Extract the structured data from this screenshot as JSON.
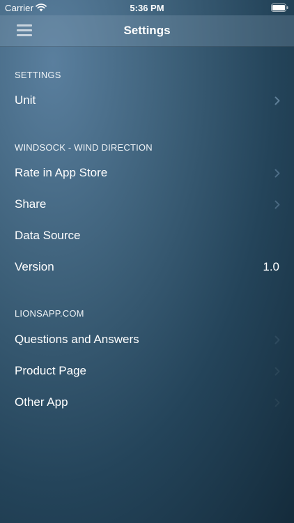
{
  "status_bar": {
    "carrier": "Carrier",
    "time": "5:36 PM"
  },
  "nav": {
    "title": "Settings",
    "menu_icon": "hamburger-menu-icon"
  },
  "sections": [
    {
      "header": "SETTINGS",
      "rows": [
        {
          "label": "Unit",
          "value": "",
          "chevron": true
        }
      ]
    },
    {
      "header": "WINDSOCK - WIND DIRECTION",
      "rows": [
        {
          "label": "Rate in App Store",
          "value": "",
          "chevron": true
        },
        {
          "label": "Share",
          "value": "",
          "chevron": true
        },
        {
          "label": "Data Source",
          "value": "",
          "chevron": false
        },
        {
          "label": "Version",
          "value": "1.0",
          "chevron": false
        }
      ]
    },
    {
      "header": "LIONSAPP.COM",
      "rows": [
        {
          "label": "Questions and Answers",
          "value": "",
          "chevron": true
        },
        {
          "label": "Product Page",
          "value": "",
          "chevron": true
        },
        {
          "label": "Other App",
          "value": "",
          "chevron": true
        }
      ]
    }
  ],
  "colors": {
    "background_top": "#5a7f9e",
    "background_bottom": "#142b3b",
    "text": "#ffffff"
  }
}
